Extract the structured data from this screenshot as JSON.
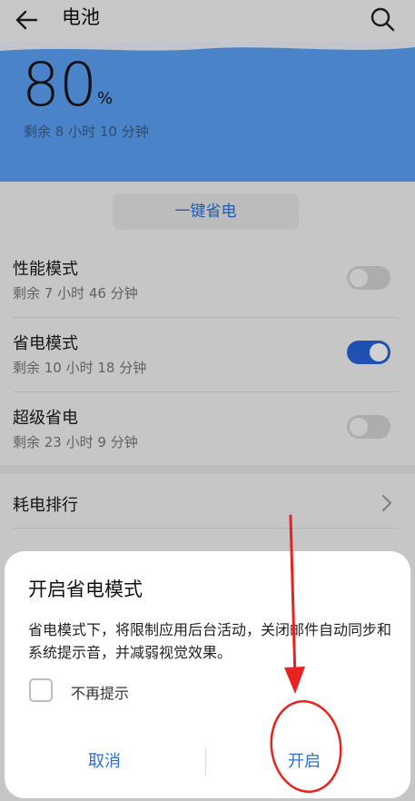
{
  "header": {
    "title": "电池",
    "back_icon": "arrow-left-icon",
    "search_icon": "search-icon"
  },
  "battery": {
    "level": "80",
    "unit": "%",
    "remaining": "剩余 8 小时 10 分钟"
  },
  "save_button_label": "一键省电",
  "modes": [
    {
      "name": "性能模式",
      "remaining": "剩余 7 小时 46 分钟",
      "enabled": false
    },
    {
      "name": "省电模式",
      "remaining": "剩余 10 小时 18 分钟",
      "enabled": true
    },
    {
      "name": "超级省电",
      "remaining": "剩余 23 小时 9 分钟",
      "enabled": false
    }
  ],
  "usage_rank": {
    "label": "耗电排行",
    "icon": "chevron-right-icon"
  },
  "dialog": {
    "title": "开启省电模式",
    "body": "省电模式下，将限制应用后台活动，关闭邮件自动同步和系统提示音，并减弱视觉效果。",
    "checkbox_label": "不再提示",
    "checkbox_checked": false,
    "cancel_label": "取消",
    "confirm_label": "开启"
  },
  "colors": {
    "accent": "#2a6fd6",
    "toggle_on": "#2563d8",
    "battery_card": "#5ba0f3",
    "annotation_red": "#e8231f"
  }
}
